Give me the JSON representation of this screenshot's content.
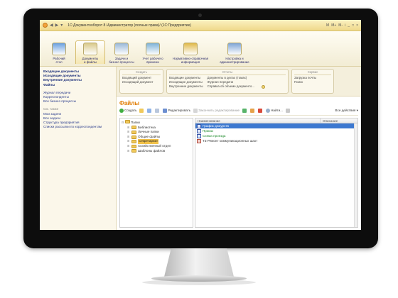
{
  "window": {
    "title": "1С:Документооборот 8 /Администратор (полные права)/  (1С:Предприятие)",
    "right_controls": [
      "M",
      "M+",
      "M-",
      "i",
      "_",
      "□",
      "×"
    ]
  },
  "sections": [
    {
      "label": "Рабочий\nстол"
    },
    {
      "label": "Документы\nи файлы"
    },
    {
      "label": "Задачи и\nбизнес-процессы"
    },
    {
      "label": "Учет рабочего\nвремени"
    },
    {
      "label": "Нормативно-справочная\nинформация"
    },
    {
      "label": "Настройка и\nадминистрирование"
    }
  ],
  "leftnav": {
    "bold_items": [
      "Входящие документы",
      "Исходящие документы",
      "Внутренние документы",
      "Файлы"
    ],
    "links_1": [
      "Журнал передачи",
      "Корреспонденты",
      "Все бизнес-процессы"
    ],
    "header": "См. также",
    "links_2": [
      "Мои задачи",
      "Все задачи",
      "Структура предприятия",
      "Списки рассылки по корреспондентам"
    ]
  },
  "panels": {
    "create": {
      "title": "Создать",
      "items": [
        "Входящий документ",
        "Исходящий документ"
      ]
    },
    "reports": {
      "title": "Отчеты",
      "col1": [
        "Входящие документы",
        "Исходящие документы",
        "Внутренние документы"
      ],
      "col2": [
        "Документы в делах (томах)",
        "Журнал передачи",
        "Справка об объеме документо..."
      ]
    },
    "service": {
      "title": "Сервис",
      "items": [
        "Загрузка почты",
        "Поиск"
      ]
    }
  },
  "files": {
    "title": "Файлы",
    "toolbar": {
      "create": "Создать",
      "edit": "Редактировать",
      "finish_edit": "Закончить редактирование",
      "find": "Найти...",
      "all_actions": "Все действия ▾"
    },
    "tree": {
      "root": "Папки",
      "folders": [
        "Библиотека",
        "Личные папки",
        "Общие файлы",
        "Секретариат",
        "Хозяйственный отдел",
        "Шаблоны файлов"
      ],
      "selected_index": 3
    },
    "list": {
      "columns": [
        "Наименование",
        "Описание"
      ],
      "rows": [
        {
          "name": "График дежурств",
          "color": "blue",
          "selected": true
        },
        {
          "name": "Приказ",
          "color": "green",
          "selected": false
        },
        {
          "name": "Схема проезда",
          "color": "green",
          "selected": false
        },
        {
          "name": "ТЗ Ремонт коммуникационных шахт",
          "color": "dark",
          "selected": false
        }
      ]
    }
  },
  "colors": {
    "accent": "#e07c00",
    "titlebar": "#efd98a",
    "selection": "#3c78d0",
    "folder_selected": "#f2c24a"
  }
}
